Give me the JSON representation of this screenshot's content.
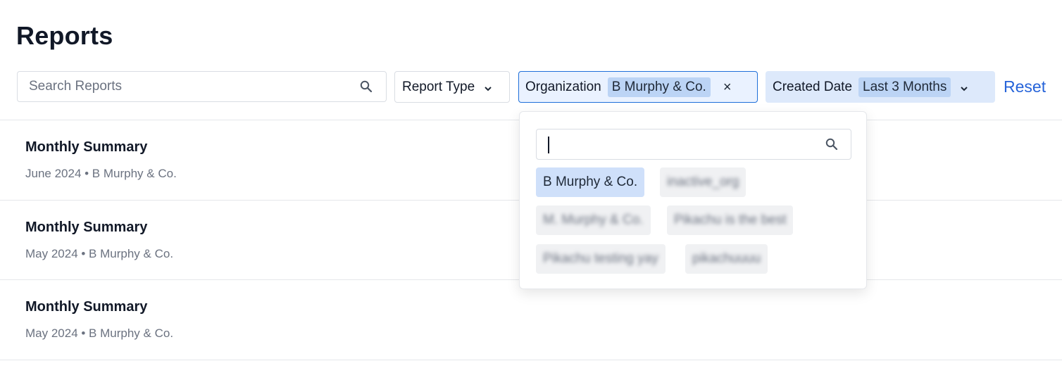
{
  "page": {
    "title": "Reports"
  },
  "search": {
    "placeholder": "Search Reports"
  },
  "filters": {
    "report_type": {
      "label": "Report Type"
    },
    "organization": {
      "label": "Organization",
      "value": "B Murphy & Co.",
      "clear_symbol": "×"
    },
    "created_date": {
      "label": "Created Date",
      "value": "Last 3 Months"
    },
    "reset_label": "Reset"
  },
  "reports": [
    {
      "title": "Monthly Summary",
      "meta": "June 2024 • B Murphy & Co."
    },
    {
      "title": "Monthly Summary",
      "meta": "May 2024 • B Murphy & Co."
    },
    {
      "title": "Monthly Summary",
      "meta": "May 2024 • B Murphy & Co."
    }
  ],
  "org_dropdown": {
    "search_value": "",
    "options": [
      {
        "label": "B Murphy & Co.",
        "selected": true
      },
      {
        "label": "inactive_org",
        "selected": false
      },
      {
        "label": "M. Murphy & Co.",
        "selected": false
      },
      {
        "label": "Pikachu is the best",
        "selected": false
      },
      {
        "label": "Pikachu testing yay",
        "selected": false
      },
      {
        "label": "pikachuuuu",
        "selected": false
      }
    ]
  },
  "icons": {
    "search": "search-icon",
    "chevron": "chevron-down-icon",
    "clear": "close-icon"
  },
  "colors": {
    "accent": "#2563d9",
    "selected_chip": "#bcd4f5",
    "active_border": "#1e6fd9"
  }
}
